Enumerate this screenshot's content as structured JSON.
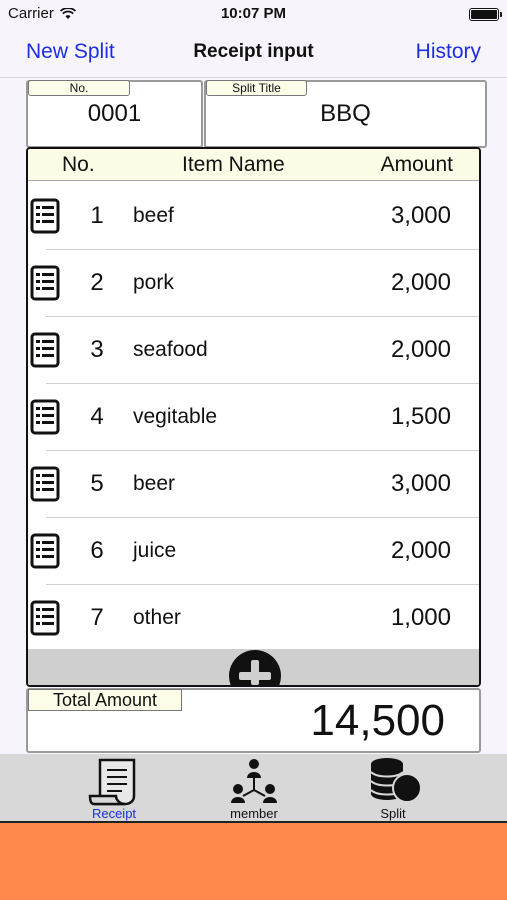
{
  "status_bar": {
    "carrier": "Carrier",
    "time": "10:07 PM"
  },
  "nav": {
    "left_button": "New Split",
    "title": "Receipt input",
    "right_button": "History"
  },
  "receipt": {
    "number_label": "No.",
    "number": "0001",
    "title_label": "Split Title",
    "title": "BBQ"
  },
  "table": {
    "headers": {
      "no": "No.",
      "item_name": "Item Name",
      "amount": "Amount"
    },
    "rows": [
      {
        "no": "1",
        "name": "beef",
        "amount": "3,000"
      },
      {
        "no": "2",
        "name": "pork",
        "amount": "2,000"
      },
      {
        "no": "3",
        "name": "seafood",
        "amount": "2,000"
      },
      {
        "no": "4",
        "name": "vegitable",
        "amount": "1,500"
      },
      {
        "no": "5",
        "name": "beer",
        "amount": "3,000"
      },
      {
        "no": "6",
        "name": "juice",
        "amount": "2,000"
      },
      {
        "no": "7",
        "name": "other",
        "amount": "1,000"
      }
    ],
    "add_icon": "plus-circle-icon"
  },
  "total": {
    "label": "Total Amount",
    "value": "14,500"
  },
  "tab_bar": {
    "tabs": [
      {
        "label": "Receipt",
        "icon": "receipt-icon",
        "selected": true
      },
      {
        "label": "member",
        "icon": "member-icon",
        "selected": false
      },
      {
        "label": "Split",
        "icon": "split-icon",
        "selected": false
      }
    ]
  },
  "colors": {
    "accent": "#1c2ee0",
    "ad_background": "#ff8a4b",
    "tag_background": "#fcfce8"
  }
}
